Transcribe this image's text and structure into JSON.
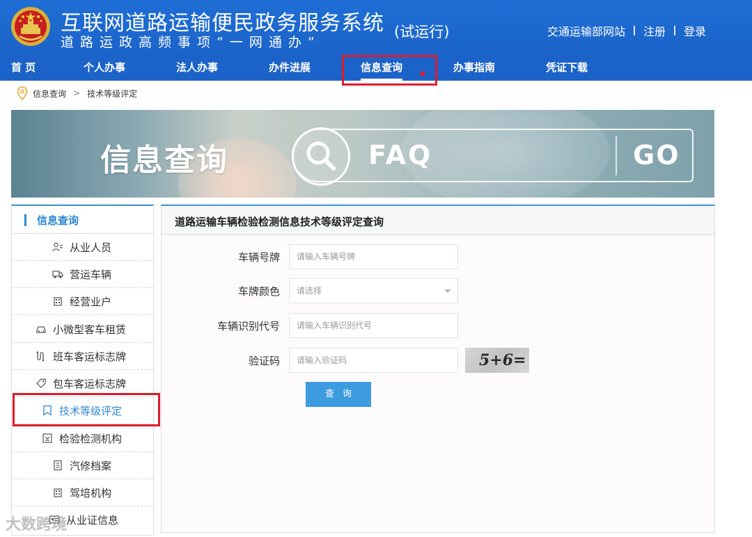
{
  "header": {
    "title": "互联网道路运输便民政务服务系统",
    "subtitle": "道路运政高频事项”一网通办”",
    "trial": "(试运行)",
    "links": {
      "ministry": "交通运输部网站",
      "register": "注册",
      "login": "登录"
    }
  },
  "nav": {
    "items": [
      {
        "label": "首 页"
      },
      {
        "label": "个人办事"
      },
      {
        "label": "法人办事"
      },
      {
        "label": "办件进展"
      },
      {
        "label": "信息查询"
      },
      {
        "label": "办事指南"
      },
      {
        "label": "凭证下载"
      }
    ],
    "active_index": 4
  },
  "breadcrumb": {
    "root": "信息查询",
    "separator": ">",
    "current": "技术等级评定"
  },
  "banner": {
    "title": "信息查询",
    "search_text": "FAQ",
    "go_label": "GO"
  },
  "sidebar": {
    "header": "信息查询",
    "items": [
      {
        "label": "从业人员",
        "icon": "person-list-icon"
      },
      {
        "label": "营运车辆",
        "icon": "truck-icon"
      },
      {
        "label": "经营业户",
        "icon": "building-icon"
      },
      {
        "label": "小微型客车租赁",
        "icon": "car-icon"
      },
      {
        "label": "班车客运标志牌",
        "icon": "route-icon"
      },
      {
        "label": "包车客运标志牌",
        "icon": "tag-icon"
      },
      {
        "label": "技术等级评定",
        "icon": "bookmark-icon"
      },
      {
        "label": "检验检测机构",
        "icon": "inspection-icon"
      },
      {
        "label": "汽修档案",
        "icon": "document-icon"
      },
      {
        "label": "驾培机构",
        "icon": "building-icon"
      },
      {
        "label": "从业证信息",
        "icon": "card-icon"
      }
    ],
    "active_index": 6
  },
  "panel": {
    "title": "道路运输车辆检验检测信息技术等级评定查询",
    "fields": {
      "plate_label": "车辆号牌",
      "plate_placeholder": "请输入车辆号牌",
      "color_label": "车牌颜色",
      "color_placeholder": "请选择",
      "vin_label": "车辆识别代号",
      "vin_placeholder": "请输入车辆识别代号",
      "captcha_label": "验证码",
      "captcha_placeholder": "请输入验证码",
      "captcha_image_text": "5+6="
    },
    "submit_label": "查询"
  },
  "watermark": "大数跨境",
  "colors": {
    "brand_blue": "#1c63c9",
    "accent_blue": "#3d9be0",
    "highlight_red": "#e0192a"
  }
}
